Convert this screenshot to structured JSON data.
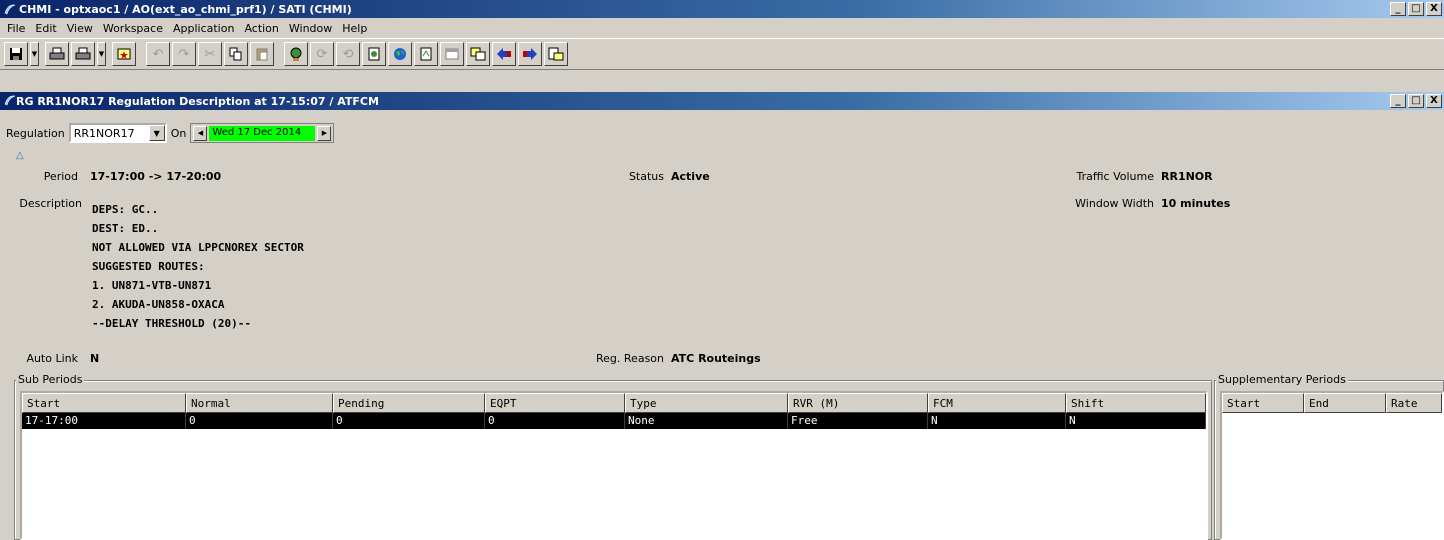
{
  "window": {
    "title": "CHMI - optxaoc1 / AO(ext_ao_chmi_prf1) / SATI (CHMI)",
    "minimize": "_",
    "maximize": "□",
    "close": "X"
  },
  "menu": [
    "File",
    "Edit",
    "View",
    "Workspace",
    "Application",
    "Action",
    "Window",
    "Help"
  ],
  "child_window": {
    "title": "RG RR1NOR17 Regulation Description at 17-15:07 / ATFCM"
  },
  "selector": {
    "regulation_label": "Regulation",
    "regulation_value": "RR1NOR17",
    "on_label": "On",
    "date_value": "Wed 17 Dec 2014"
  },
  "details": {
    "period_label": "Period",
    "period_value": "17-17:00 -> 17-20:00",
    "status_label": "Status",
    "status_value": "Active",
    "traffic_volume_label": "Traffic Volume",
    "traffic_volume_value": "RR1NOR",
    "window_width_label": "Window Width",
    "window_width_value": "10 minutes",
    "description_label": "Description",
    "description_lines": [
      "DEPS: GC..",
      "DEST: ED..",
      "NOT ALLOWED VIA LPPCNOREX SECTOR",
      "SUGGESTED ROUTES:",
      "1. UN871-VTB-UN871",
      "2. AKUDA-UN858-OXACA",
      "--DELAY THRESHOLD (20)--"
    ],
    "auto_link_label": "Auto Link",
    "auto_link_value": "N",
    "reg_reason_label": "Reg. Reason",
    "reg_reason_value": "ATC Routeings"
  },
  "sub_periods": {
    "title": "Sub Periods",
    "columns": [
      "Start",
      "Normal",
      "Pending",
      "EQPT",
      "Type",
      "RVR (M)",
      "FCM",
      "Shift"
    ],
    "rows": [
      [
        "17-17:00",
        "0",
        "0",
        "0",
        "None",
        "Free",
        "N",
        "N"
      ]
    ]
  },
  "supplementary_periods": {
    "title": "Supplementary Periods",
    "columns": [
      "Start",
      "End",
      "Rate"
    ]
  }
}
